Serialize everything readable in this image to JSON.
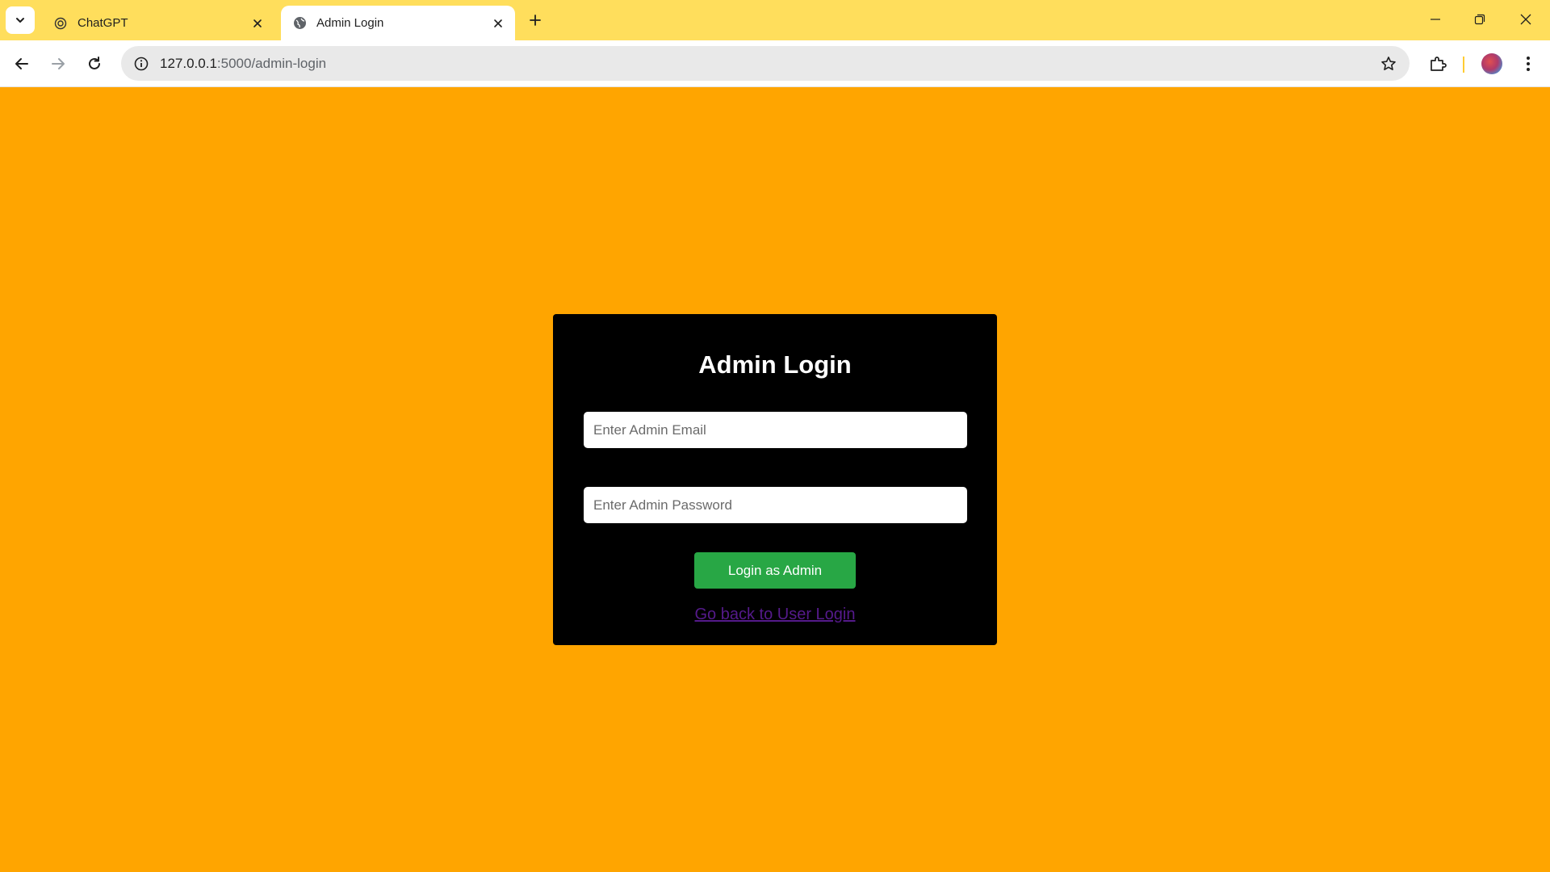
{
  "browser": {
    "tabs": [
      {
        "title": "ChatGPT",
        "active": false,
        "favicon": "chatgpt-icon"
      },
      {
        "title": "Admin Login",
        "active": true,
        "favicon": "globe-icon"
      }
    ],
    "url_host": "127.0.0.1",
    "url_path": ":5000/admin-login"
  },
  "colors": {
    "page_background": "#ffa500",
    "tabstrip": "#ffde5c",
    "card_background": "#000000",
    "button": "#28a745",
    "link": "#551a8b"
  },
  "login": {
    "heading": "Admin Login",
    "email_placeholder": "Enter Admin Email",
    "password_placeholder": "Enter Admin Password",
    "submit_label": "Login as Admin",
    "back_link": "Go back to User Login"
  }
}
